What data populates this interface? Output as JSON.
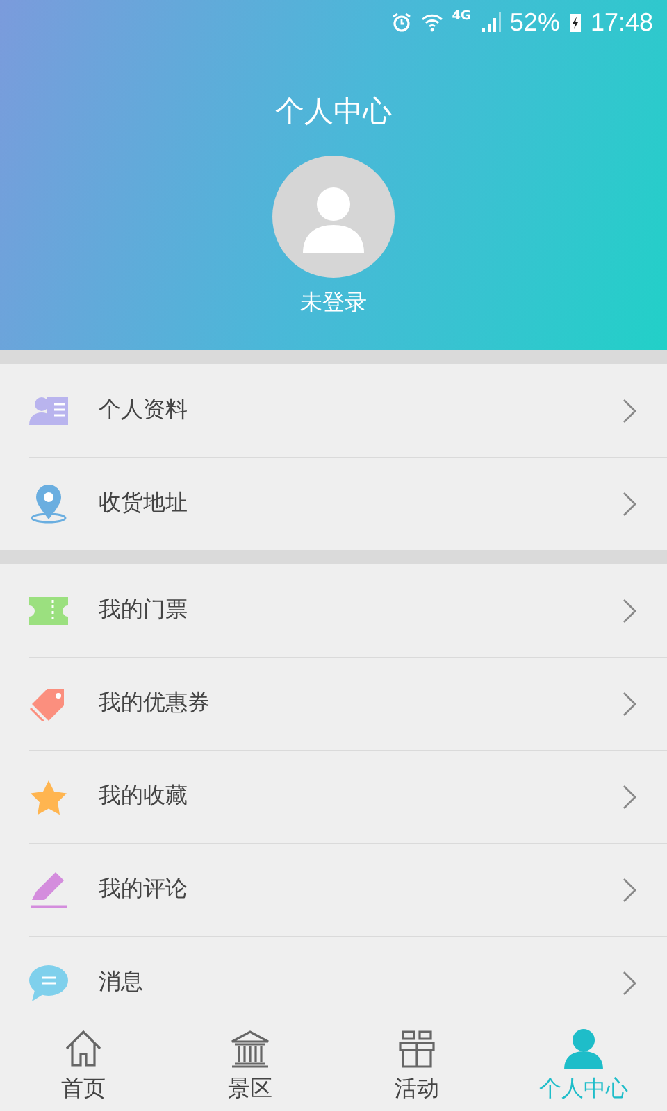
{
  "status_bar": {
    "network": "4G",
    "battery": "52%",
    "time": "17:48"
  },
  "header": {
    "title": "个人中心",
    "login_status": "未登录"
  },
  "menu_groups": [
    {
      "items": [
        {
          "kind": "profile",
          "label": "个人资料"
        },
        {
          "kind": "address",
          "label": "收货地址"
        }
      ]
    },
    {
      "items": [
        {
          "kind": "ticket",
          "label": "我的门票"
        },
        {
          "kind": "coupon",
          "label": "我的优惠券"
        },
        {
          "kind": "favorite",
          "label": "我的收藏"
        },
        {
          "kind": "review",
          "label": "我的评论"
        },
        {
          "kind": "message",
          "label": "消息"
        }
      ]
    }
  ],
  "tab_bar": [
    {
      "kind": "home",
      "label": "首页",
      "selected": false
    },
    {
      "kind": "scenic",
      "label": "景区",
      "selected": false
    },
    {
      "kind": "activity",
      "label": "活动",
      "selected": false
    },
    {
      "kind": "me",
      "label": "个人中心",
      "selected": true
    }
  ]
}
